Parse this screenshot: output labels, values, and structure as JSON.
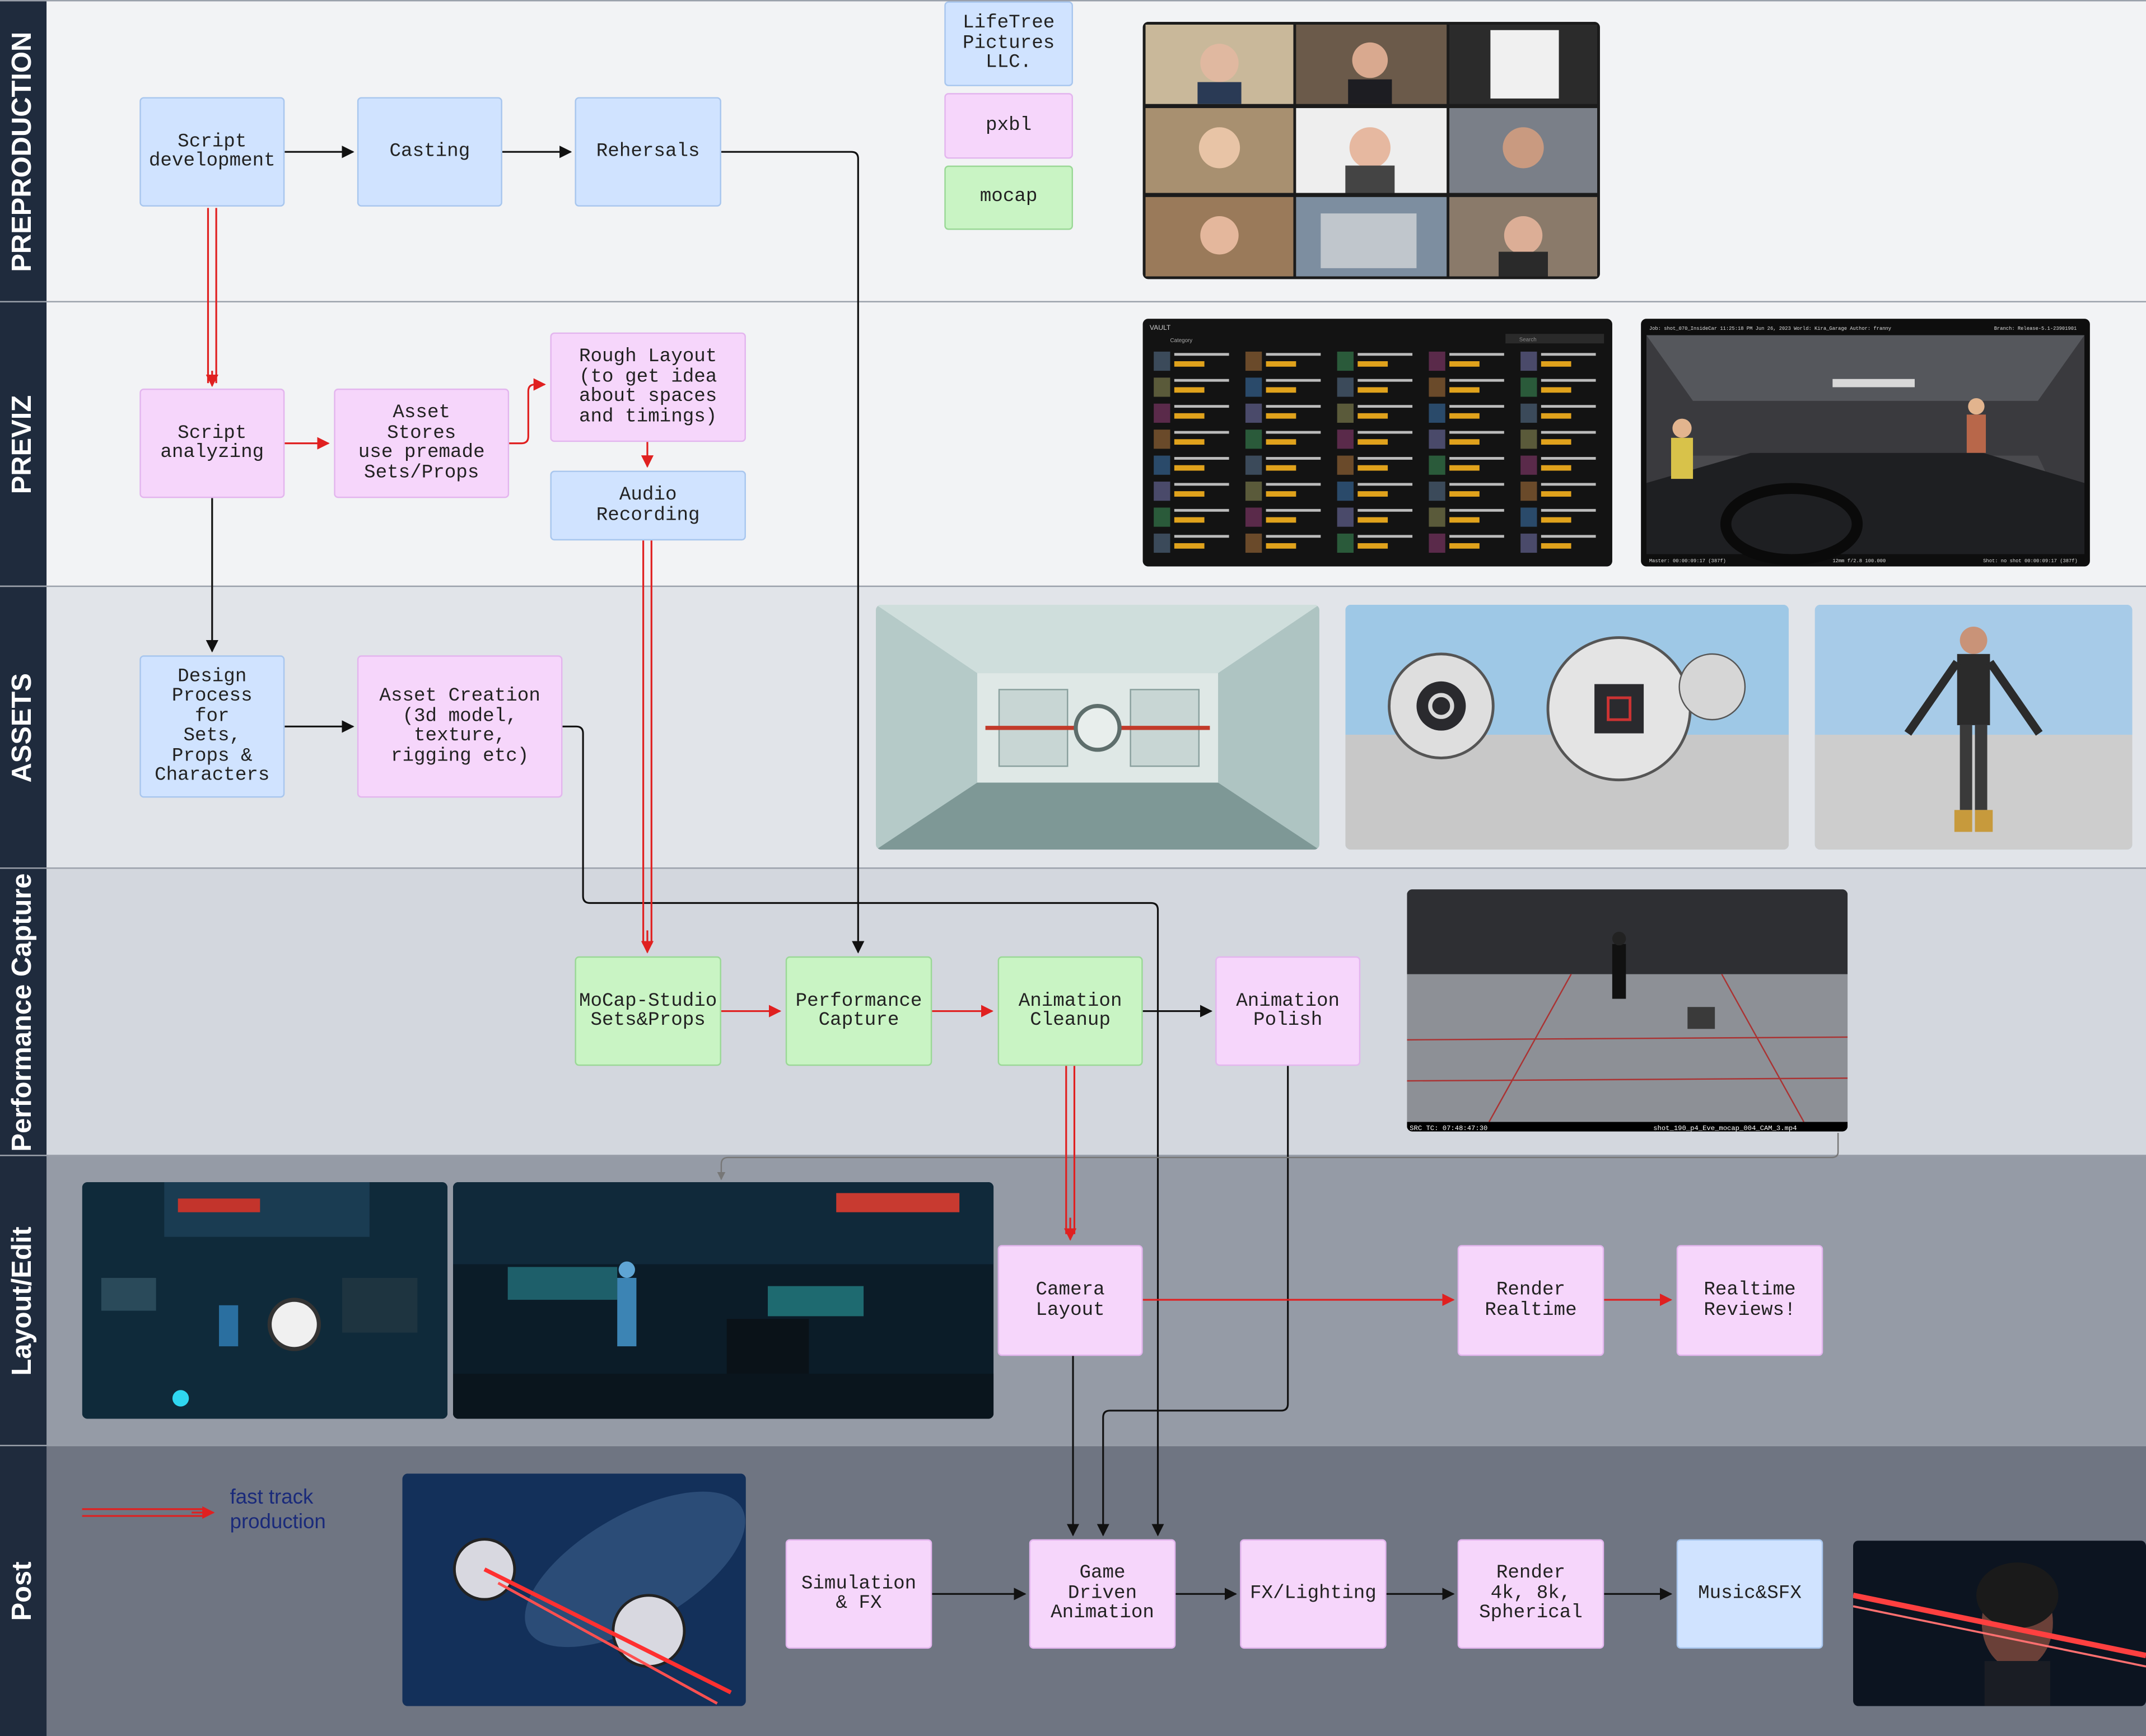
{
  "lanes": [
    {
      "id": "preproduction",
      "label": "PREPRODUCTION",
      "bg": "#f2f3f5"
    },
    {
      "id": "previz",
      "label": "PREVIZ",
      "bg": "#f2f3f5"
    },
    {
      "id": "assets",
      "label": "ASSETS",
      "bg": "#e1e4e9"
    },
    {
      "id": "performance",
      "label": "Performance Capture",
      "bg": "#d3d7de"
    },
    {
      "id": "layout",
      "label": "Layout/Edit",
      "bg": "#959ba6"
    },
    {
      "id": "post",
      "label": "Post",
      "bg": "#6f7582"
    }
  ],
  "legend": {
    "companies": [
      {
        "label": "LifeTree\nPictures\nLLC.",
        "color": "#d0e3ff"
      },
      {
        "label": "pxbl",
        "color": "#f6d6fb"
      },
      {
        "label": "mocap",
        "color": "#c9f4c4"
      }
    ],
    "fast_track": "fast track\nproduction",
    "fast_track_color": "#e02020"
  },
  "nodes": {
    "script_development": "Script\ndevelopment",
    "casting": "Casting",
    "rehersals": "Rehersals",
    "script_analyzing": "Script\nanalyzing",
    "asset_stores": "Asset\nStores\nuse premade\nSets/Props",
    "rough_layout": "Rough Layout\n(to get idea\nabout spaces\nand timings)",
    "audio_recording": "Audio\nRecording",
    "design_process": "Design\nProcess\nfor\nSets,\nProps &\nCharacters",
    "asset_creation": "Asset Creation\n(3d model,\ntexture,\nrigging etc)",
    "mocap_studio": "MoCap-Studio\nSets&Props",
    "performance_capture": "Performance\nCapture",
    "animation_cleanup": "Animation\nCleanup",
    "animation_polish": "Animation\nPolish",
    "camera_layout": "Camera\nLayout",
    "render_realtime": "Render\nRealtime",
    "realtime_reviews": "Realtime\nReviews!",
    "simulation_fx": "Simulation\n& FX",
    "game_driven_animation": "Game\nDriven\nAnimation",
    "fx_lighting": "FX/Lighting",
    "render_4k": "Render\n4k, 8k,\nSpherical",
    "music_sfx": "Music&SFX"
  },
  "screenshots": {
    "vault": {
      "header": "VAULT",
      "filter": "Category",
      "search": "Search"
    },
    "car": {
      "top_left": "Job: shot_070_InsideCar 11:25:18 PM Jun 26, 2023 World: Kira_Garage Author: franny",
      "top_right": "Branch: Release-5.1-23901901",
      "bottom_left": "Master: 00:00:09:17 (387f)",
      "bottom_mid": "12mm f/2.8 100.000",
      "bottom_right": "Shot: no shot 00:00:09:17 (387f)"
    },
    "mocap": {
      "tc": "SRC TC: 07:48:47:30",
      "file": "shot_190_p4_Eve_mocap_004_CAM_3.mp4"
    }
  },
  "colors": {
    "red_arrow": "#e02020",
    "black_arrow": "#111111",
    "lane_label_bg": "#1f2b3d"
  }
}
